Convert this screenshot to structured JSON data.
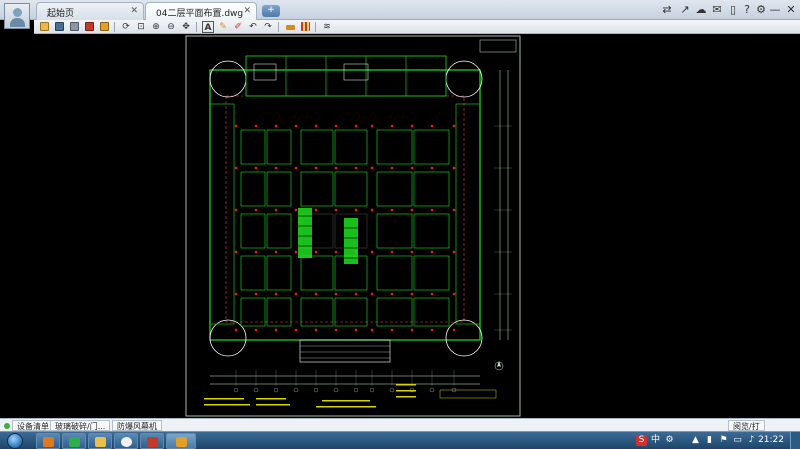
{
  "window": {
    "tabs": [
      {
        "label": "起始页",
        "close": "✕"
      },
      {
        "label": "04二层平面布置.dwg",
        "close": "✕"
      }
    ],
    "new_tab": "+",
    "right_icons": [
      "user-switch-icon",
      "share-icon",
      "cloud-icon",
      "chat-icon",
      "phone-icon",
      "help-icon",
      "settings-icon"
    ],
    "controls": {
      "minimize": "—",
      "maximize": "☐",
      "close": "✕"
    }
  },
  "toolbar": {
    "groups": [
      [
        "open-icon",
        "save-icon",
        "print-icon",
        "export-pdf-icon",
        "lock-icon"
      ],
      [
        "rotate-icon",
        "zoom-window-icon",
        "zoom-in-icon",
        "zoom-out-icon",
        "pan-icon"
      ],
      [
        "text-icon",
        "pen-icon",
        "markup-icon",
        "undo-icon",
        "redo-icon"
      ],
      [
        "measure-icon",
        "area-icon"
      ],
      [
        "layer-icon"
      ]
    ],
    "text_tool": "A",
    "colors": {
      "accent": "#2e6aa6",
      "icon": "#4a6f94",
      "warn": "#d98a1c",
      "red": "#c23a2b"
    }
  },
  "drawing": {
    "file": "04二层平面布置.dwg",
    "background": "#000000",
    "colors": {
      "frame": "#cfe8cf",
      "wall": "#20e020",
      "column": "#e02020",
      "grid": "#a0a0a0",
      "accent": "#d4d400",
      "cyan": "#00c8c8",
      "white": "#ffffff"
    }
  },
  "status": {
    "items": [
      {
        "label": "设备清单",
        "dot": "#3ab03a"
      },
      {
        "label": "玻璃破碎/门..."
      },
      {
        "label": "防爆风幕机"
      }
    ],
    "right": "阅览/打"
  },
  "taskbar": {
    "apps": [
      "browser-icon",
      "cad-viewer-icon",
      "folder-icon",
      "qq-icon",
      "file-manager-icon",
      "books-icon",
      "dwg-viewer-icon"
    ],
    "tray": {
      "ime": "S",
      "ime_mode": "中",
      "time": "21:22"
    }
  }
}
